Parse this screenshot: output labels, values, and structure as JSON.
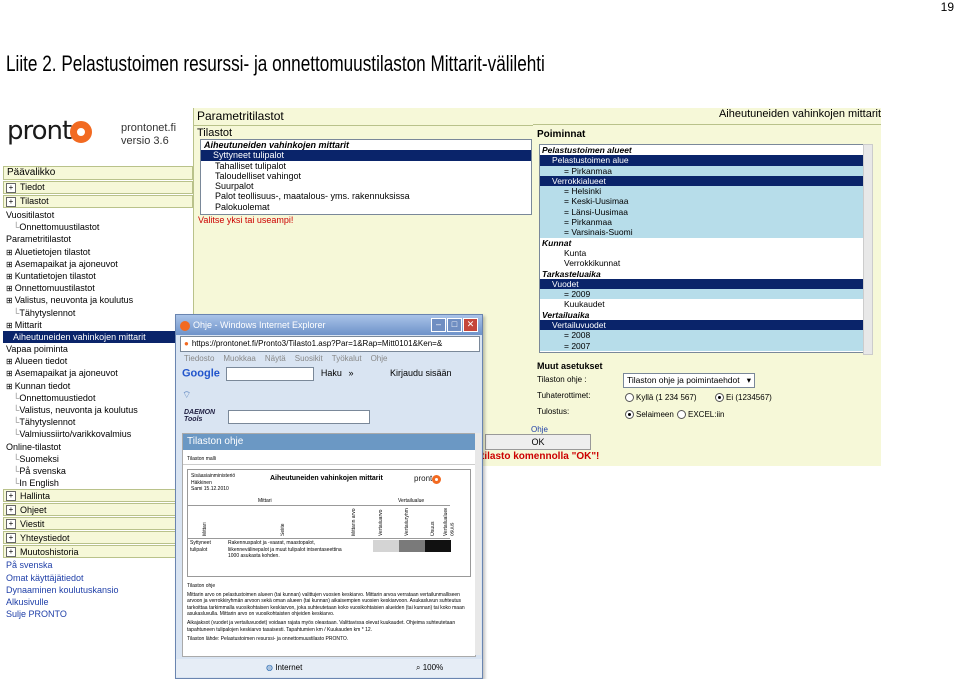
{
  "page_number": "19",
  "doc_title": "Liite 2. Pelastustoimen resurssi- ja onnettomuustilaston Mittarit-välilehti",
  "app": {
    "logo_text": "pront",
    "site": "prontonet.fi",
    "version": "versio 3.6"
  },
  "left_nav": {
    "header": "Päävalikko",
    "items": [
      {
        "type": "btn",
        "label": "Tiedot"
      },
      {
        "type": "btn",
        "label": "Tilastot"
      },
      {
        "type": "h",
        "label": "Vuositilastot"
      },
      {
        "type": "l2",
        "label": "Onnettomuustilastot"
      },
      {
        "type": "h",
        "label": "Parametritilastot"
      },
      {
        "type": "l1",
        "label": "Aluetietojen tilastot"
      },
      {
        "type": "l1",
        "label": "Asemapaikat ja ajoneuvot"
      },
      {
        "type": "l1",
        "label": "Kuntatietojen tilastot"
      },
      {
        "type": "l1",
        "label": "Onnettomuustilastot"
      },
      {
        "type": "l1",
        "label": "Valistus, neuvonta ja koulutus"
      },
      {
        "type": "l2",
        "label": "Tähytyslennot"
      },
      {
        "type": "l1",
        "label": "Mittarit"
      },
      {
        "type": "sel",
        "label": "Aiheutuneiden vahinkojen mittarit"
      },
      {
        "type": "h",
        "label": "Vapaa poiminta"
      },
      {
        "type": "l1",
        "label": "Alueen tiedot"
      },
      {
        "type": "l1",
        "label": "Asemapaikat ja ajoneuvot"
      },
      {
        "type": "l1",
        "label": "Kunnan tiedot"
      },
      {
        "type": "l2",
        "label": "Onnettomuustiedot"
      },
      {
        "type": "l2",
        "label": "Valistus, neuvonta ja koulutus"
      },
      {
        "type": "l2",
        "label": "Tähytyslennot"
      },
      {
        "type": "l2",
        "label": "Valmiussiirto/varikkovalmius"
      },
      {
        "type": "h",
        "label": "Online-tilastot"
      },
      {
        "type": "l2",
        "label": "Suomeksi"
      },
      {
        "type": "l2",
        "label": "På svenska"
      },
      {
        "type": "l2",
        "label": "In English"
      },
      {
        "type": "btn",
        "label": "Hallinta"
      },
      {
        "type": "btn",
        "label": "Ohjeet"
      },
      {
        "type": "btn",
        "label": "Viestit"
      },
      {
        "type": "btn",
        "label": "Yhteystiedot"
      },
      {
        "type": "btn",
        "label": "Muutoshistoria"
      },
      {
        "type": "link",
        "label": "På svenska"
      },
      {
        "type": "link",
        "label": "Omat käyttäjätiedot"
      },
      {
        "type": "link",
        "label": "Dynaaminen koulutuskansio"
      },
      {
        "type": "link",
        "label": "Alkusivulle"
      },
      {
        "type": "link",
        "label": "Sulje PRONTO"
      }
    ]
  },
  "center": {
    "header": "Parametritilastot",
    "subheader": "Tilastot",
    "list": [
      {
        "style": "hdr",
        "label": "Aiheutuneiden vahinkojen mittarit"
      },
      {
        "style": "sel",
        "label": "Syttyneet tulipalot"
      },
      {
        "style": "",
        "label": "Tahalliset tulipalot"
      },
      {
        "style": "",
        "label": "Taloudelliset vahingot"
      },
      {
        "style": "",
        "label": "Suurpalot"
      },
      {
        "style": "",
        "label": "Palot teollisuus-, maatalous- yms. rakennuksissa"
      },
      {
        "style": "",
        "label": "Palokuolemat"
      }
    ],
    "warning": "Valitse yksi tai useampi!"
  },
  "right": {
    "title": "Aiheutuneiden vahinkojen mittarit",
    "section": "Poiminnat",
    "list": [
      {
        "style": "it",
        "label": "Pelastustoimen alueet"
      },
      {
        "style": "sel",
        "label": "Pelastustoimen alue"
      },
      {
        "style": "hl",
        "label": "= Pirkanmaa"
      },
      {
        "style": "sel",
        "label": "Verrokkialueet"
      },
      {
        "style": "hl",
        "label": "= Helsinki"
      },
      {
        "style": "hl",
        "label": "= Keski-Uusimaa"
      },
      {
        "style": "hl",
        "label": "= Länsi-Uusimaa"
      },
      {
        "style": "hl",
        "label": "= Pirkanmaa"
      },
      {
        "style": "hl",
        "label": "= Varsinais-Suomi"
      },
      {
        "style": "it",
        "label": "Kunnat"
      },
      {
        "style": "",
        "label": "Kunta"
      },
      {
        "style": "",
        "label": "Verrokkikunnat"
      },
      {
        "style": "it",
        "label": "Tarkasteluaika"
      },
      {
        "style": "sel",
        "label": "Vuodet"
      },
      {
        "style": "hl",
        "label": "= 2009"
      },
      {
        "style": "",
        "label": "Kuukaudet"
      },
      {
        "style": "it",
        "label": "Vertailuaika"
      },
      {
        "style": "sel",
        "label": "Vertailuvuodet"
      },
      {
        "style": "hl",
        "label": "= 2008"
      },
      {
        "style": "hl",
        "label": "= 2007"
      }
    ],
    "muut": "Muut asetukset",
    "ohje_label": "Tilaston ohje :",
    "ohje_value": "Tilaston ohje ja poimintaehdot",
    "tuhat_label": "Tuhaterottimet:",
    "tuhat_opt1": "Kyllä (1 234 567)",
    "tuhat_opt2": "Ei (1234567)",
    "tulostus_label": "Tulostus:",
    "tulostus_opt1": "Selaimeen",
    "tulostus_opt2": "EXCEL:iin",
    "ohje_link": "Ohje",
    "ok_button": "OK",
    "ok_message": "tilasto komennolla \"OK\"!"
  },
  "ie": {
    "title": "Ohje - Windows Internet Explorer",
    "address": "https://prontonet.fi/Pronto3/Tilasto1.asp?Par=1&Rap=Mitt0101&Ken=&",
    "menu": [
      "Tiedosto",
      "Muokkaa",
      "Näytä",
      "Suosikit",
      "Työkalut",
      "Ohje"
    ],
    "google": "Google",
    "haku": "Haku",
    "kirjaudu": "Kirjaudu sisään",
    "daemon": "DAEMON",
    "tools": "Tools",
    "content_title": "Tilaston ohje",
    "malli": "Tilaston malli",
    "ministry": "Sisäasiainministeriö",
    "author": "Häkkinen",
    "date": "Sami 15.12.2010",
    "report_title": "Aiheutuneiden vahinkojen mittarit",
    "col_mittari": "Mittari",
    "col_vertailu": "Vertailualue",
    "col_hdrs": [
      "Mittari",
      "Selite",
      "Mittarin arvo",
      "Vertailuarvo",
      "Vertailuryhmä",
      "Osuus",
      "Vertailualueen osuus"
    ],
    "row_label": "Syttyneet tulipalot",
    "row_desc": "Rakennuspalot ja -vaarat, maastopalot, liikennevälinepalot ja muut tulipalot intsentaseettina 1000 asukasta kohden.",
    "ohje_heading": "Tilaston ohje",
    "ohje_text1": "Mittarin arvo on pelastustoimen alueen (tai kunnan) valittujen vuosien keskiarvo. Mittarin arvoa verrataan vertailunmalliseen arvoon ja verrokkiryhmän arvoon sekä oman alueen (tai kunnan) aikaisempien vuosien keskiarvoon. Asukasluvun suhteutus tarkoittaa tarkimmalla vuosikohtaisen keskiarvon, joka suhteutetaan koko vuosikohtaisien alueiden (tai kunnan) tai koko maan asukasluvulla. Mittarin arvo on vuosikohtaisten ohjeiden keskiarvo.",
    "ohje_text2": "Aikajaksot (vuodet ja vertailuvuodet) voidaan rajata myös oleastaan. Valittavissa olevat kuukaudet. Ohjeima suhteutetaan tapahtuneen tulipalojen keskiarvo tasaisesti. Tapahtumien km / Kuukauden km * 12.",
    "ohje_text3": "Tilaston lähde: Pelastustoimen resurssi- ja onnettomuustilasto PRONTO.",
    "status_zone": "Internet",
    "zoom": "100%"
  }
}
